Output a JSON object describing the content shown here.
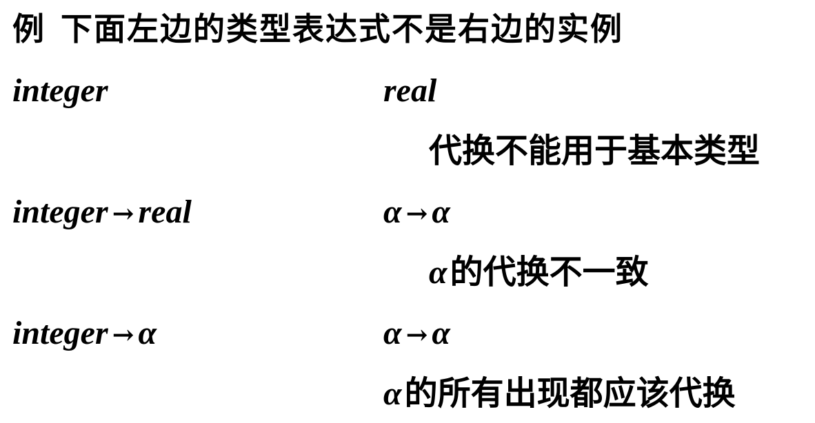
{
  "heading": {
    "lead": "例",
    "text": "下面左边的类型表达式不是右边的实例"
  },
  "arrow_symbol": "→",
  "rows": [
    {
      "left": {
        "a": "integer"
      },
      "right": {
        "a": "real"
      },
      "note": {
        "greek": "",
        "text": "代换不能用于基本类型"
      }
    },
    {
      "left": {
        "a": "integer",
        "b": "real"
      },
      "right": {
        "a": "α",
        "b": "α"
      },
      "note": {
        "greek": "α",
        "text": "的代换不一致"
      }
    },
    {
      "left": {
        "a": "integer",
        "b": "α"
      },
      "right": {
        "a": "α",
        "b": "α"
      },
      "note": {
        "greek": "α",
        "text": "的所有出现都应该代换"
      }
    }
  ]
}
